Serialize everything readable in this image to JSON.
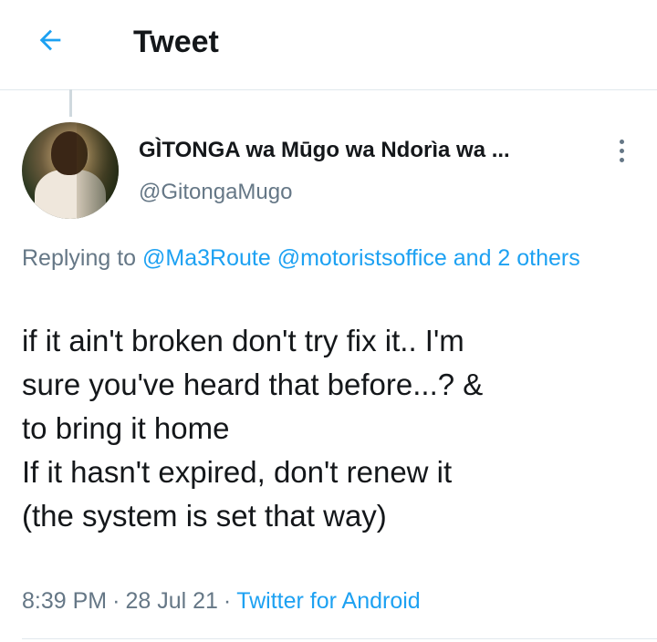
{
  "header": {
    "title": "Tweet",
    "back_icon": "arrow-left-icon"
  },
  "tweet": {
    "display_name": "GÌTONGA wa Mūgo wa Ndorìa wa ...",
    "handle": "@GitongaMugo",
    "replying": {
      "prefix": "Replying to ",
      "mention_1": "@Ma3Route",
      "mention_2": "@motoristsoffice",
      "others": "and 2 others"
    },
    "lines": [
      "if it ain't broken don't try fix it.. I'm",
      "sure you've heard that before...? &",
      "to bring it home",
      "If it hasn't expired, don't renew it",
      "(the system is set that way)"
    ],
    "time": "8:39 PM",
    "date": "28 Jul 21",
    "source": "Twitter for Android",
    "separator": "·"
  },
  "colors": {
    "accent": "#1da1f2",
    "muted": "#657786",
    "text": "#14171a",
    "divider": "#e1e8ed"
  }
}
